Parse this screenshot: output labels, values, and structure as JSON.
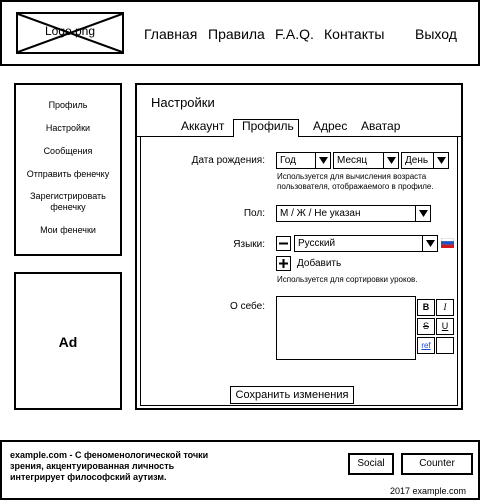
{
  "header": {
    "logo_label": "Logo.png",
    "nav": [
      "Главная",
      "Правила",
      "F.A.Q.",
      "Контакты"
    ],
    "logout": "Выход"
  },
  "sidebar": {
    "items": [
      "Профиль",
      "Настройки",
      "Сообщения",
      "Отправить фенечку",
      "Зарегистрировать фенечку",
      "Мои фенечки"
    ]
  },
  "ad": {
    "label": "Ad"
  },
  "main": {
    "title": "Настройки",
    "tabs": [
      "Аккаунт",
      "Профиль",
      "Адрес",
      "Аватар"
    ],
    "active_tab": "Профиль",
    "birth": {
      "label": "Дата рождения:",
      "year": "Год",
      "month": "Месяц",
      "day": "День",
      "hint": "Используется для вычисления возраста пользователя, отображаемого в профиле."
    },
    "gender": {
      "label": "Пол:",
      "value": "М / Ж / Не указан"
    },
    "languages": {
      "label": "Языки:",
      "value": "Русский",
      "add": "Добавить",
      "hint": "Используется для сортировки уроков."
    },
    "about": {
      "label": "О себе:",
      "toolbar": [
        "B",
        "I",
        "S",
        "U",
        "ref",
        ""
      ]
    },
    "save": "Сохранить изменения"
  },
  "footer": {
    "text": "example.com - С феноменологической точки зрения, акцентуированная личность интегрирует философский аутизм.",
    "social": "Social",
    "counter": "Counter",
    "copyright": "2017 example.com"
  },
  "colors": {
    "flag_white": "#ffffff",
    "flag_blue": "#1f4fc4",
    "flag_red": "#d0191c",
    "link": "#1a4fd6"
  }
}
